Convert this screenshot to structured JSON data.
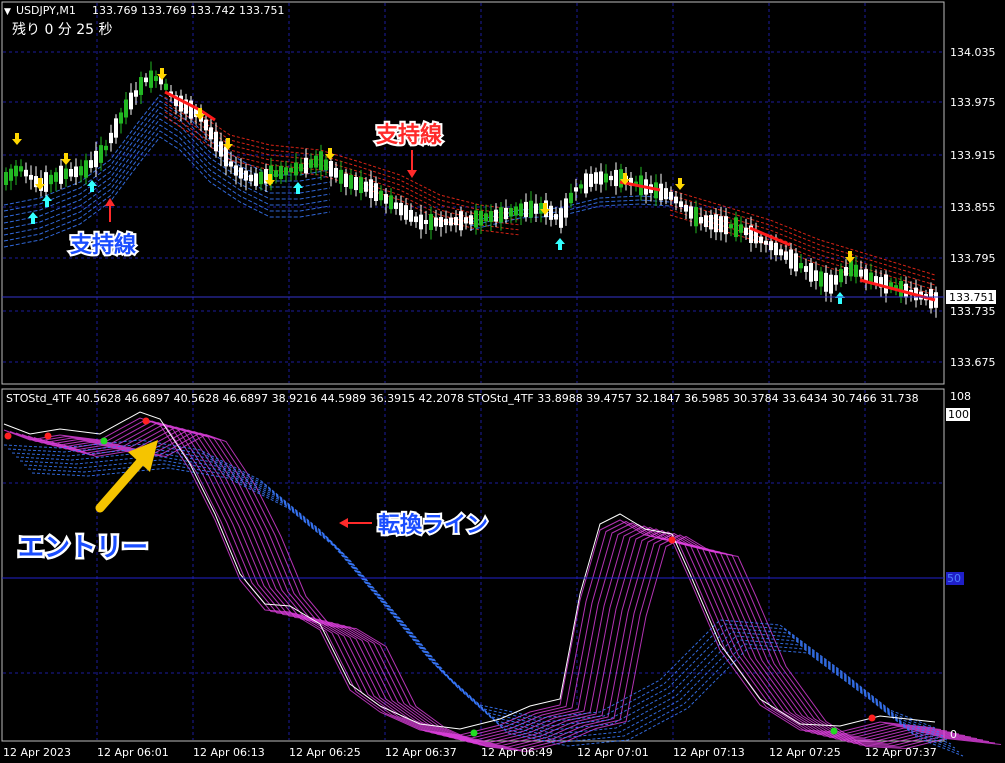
{
  "header": {
    "menu_glyph": "▼",
    "symbol": "USDJPY,M1",
    "ohlc": "133.769 133.769 133.742 133.751",
    "timer": "残り 0 分 25 秒"
  },
  "indicator_header": "STOStd_4TF 40.5628 46.6897 40.5628 46.6897 38.9216 44.5989 36.3915 42.2078 STOStd_4TF 33.8988 39.4757 32.1847 36.5985 30.3784 33.6434 30.7466 31.738",
  "price_axis": [
    "134.035",
    "133.975",
    "133.915",
    "133.855",
    "133.795",
    "133.735",
    "133.675"
  ],
  "current_price": "133.751",
  "osc_axis": {
    "top": "108",
    "hundred": "100",
    "fifty": "50",
    "zero": "0"
  },
  "time_axis": [
    "12 Apr 2023",
    "12 Apr 06:01",
    "12 Apr 06:13",
    "12 Apr 06:25",
    "12 Apr 06:37",
    "12 Apr 06:49",
    "12 Apr 07:01",
    "12 Apr 07:13",
    "12 Apr 07:25",
    "12 Apr 07:37"
  ],
  "annotations": {
    "support_red": "支持線",
    "support_blue": "支持線",
    "turn_line": "転換ライン",
    "entry": "エントリー"
  },
  "colors": {
    "background": "#000000",
    "grid": "#1c1c9c",
    "bull_candle": "#22b822",
    "bear_candle": "#ffffff",
    "down_ribbon": "#ff2a1a",
    "up_ribbon": "#3a7aff",
    "magenta": "#e040e0",
    "signal_up": "#33ffff",
    "signal_down": "#ffd700"
  }
}
